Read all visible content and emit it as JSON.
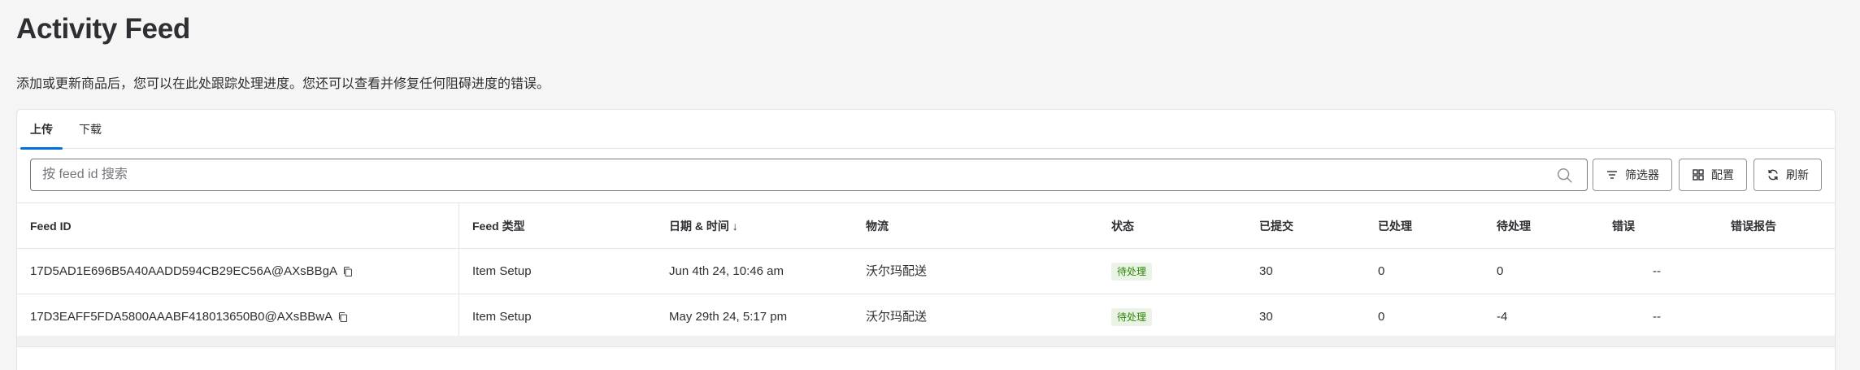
{
  "page": {
    "title": "Activity Feed",
    "subtitle": "添加或更新商品后，您可以在此处跟踪处理进度。您还可以查看并修复任何阻碍进度的错误。"
  },
  "tabs": [
    {
      "label": "上传",
      "active": true
    },
    {
      "label": "下载",
      "active": false
    }
  ],
  "search": {
    "value": "",
    "placeholder": "按 feed id 搜索"
  },
  "toolbar": {
    "filter_label": "筛选器",
    "config_label": "配置",
    "refresh_label": "刷新"
  },
  "table": {
    "headers": [
      "Feed ID",
      "Feed 类型",
      "日期 & 时间 ↓",
      "物流",
      "状态",
      "已提交",
      "已处理",
      "待处理",
      "错误",
      "错误报告"
    ],
    "rows": [
      {
        "feed_id": "17D5AD1E696B5A40AADD594CB29EC56A@AXsBBgA",
        "feed_type": "Item Setup",
        "datetime": "Jun 4th 24, 10:46 am",
        "logistics": "沃尔玛配送",
        "status": "待处理",
        "submitted": "30",
        "processed": "0",
        "pending": "0",
        "errors": "--",
        "error_report": ""
      },
      {
        "feed_id": "17D3EAFF5FDA5800AAABF418013650B0@AXsBBwA",
        "feed_type": "Item Setup",
        "datetime": "May 29th 24, 5:17 pm",
        "logistics": "沃尔玛配送",
        "status": "待处理",
        "submitted": "30",
        "processed": "0",
        "pending": "-4",
        "errors": "--",
        "error_report": ""
      }
    ]
  },
  "colors": {
    "accent": "#0071dc",
    "status_pending_bg": "#eaf3e6",
    "status_pending_text": "#2a8703"
  },
  "icons": {
    "search": "search-icon",
    "filter": "filter-icon",
    "config": "grid-icon",
    "refresh": "refresh-icon",
    "copy": "copy-icon"
  }
}
